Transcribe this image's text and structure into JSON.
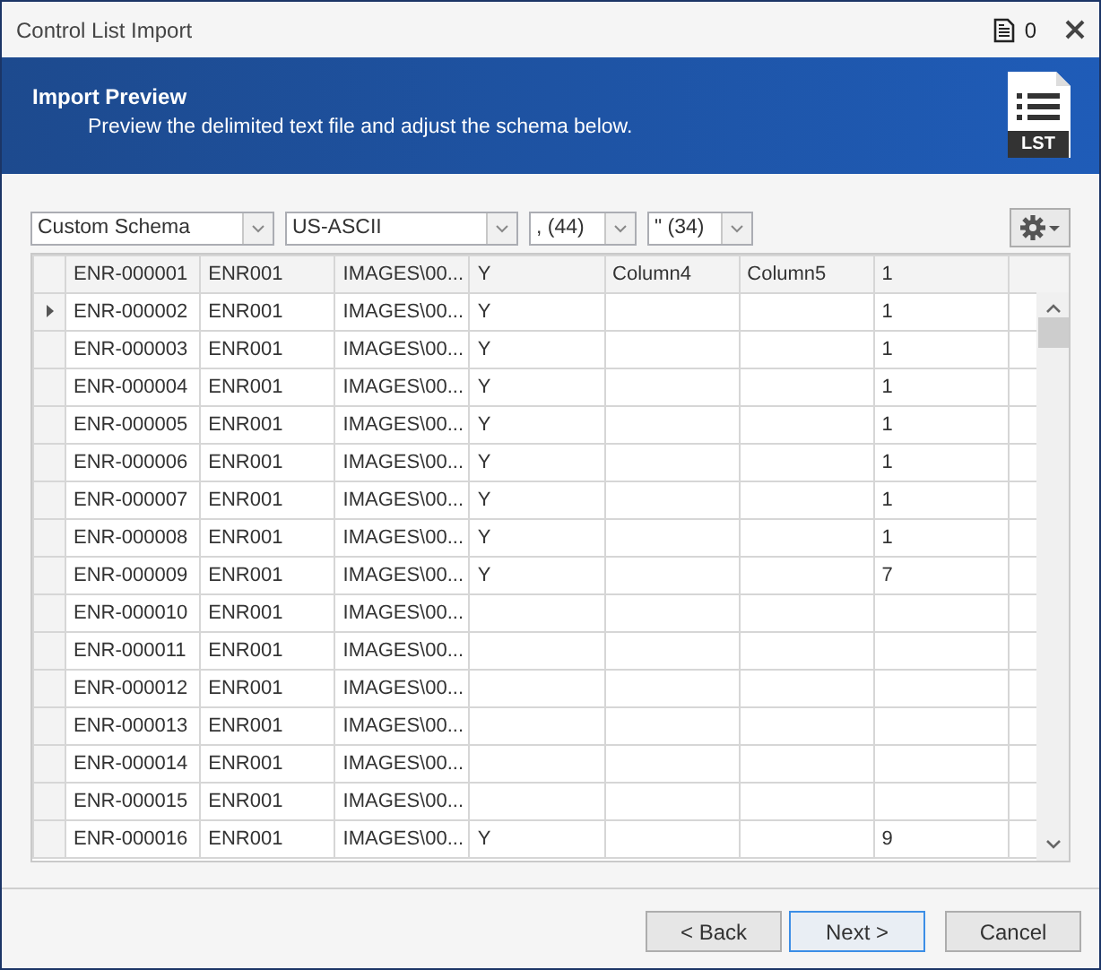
{
  "window": {
    "title": "Control List Import",
    "notification_count": "0"
  },
  "banner": {
    "title": "Import Preview",
    "subtitle": "Preview the delimited text file and adjust the schema below.",
    "file_badge": "LST"
  },
  "toolbar": {
    "dropdowns": [
      {
        "value": "Custom Schema"
      },
      {
        "value": "US-ASCII"
      },
      {
        "value": ", (44)"
      },
      {
        "value": "\" (34)"
      }
    ]
  },
  "grid": {
    "header_row": [
      "ENR-000001",
      "ENR001",
      "IMAGES\\00...",
      "Y",
      "Column4",
      "Column5",
      "1"
    ],
    "rows": [
      {
        "selected": true,
        "cells": [
          "ENR-000002",
          "ENR001",
          "IMAGES\\00...",
          "Y",
          null,
          null,
          "1"
        ]
      },
      {
        "selected": false,
        "cells": [
          "ENR-000003",
          "ENR001",
          "IMAGES\\00...",
          "Y",
          null,
          null,
          "1"
        ]
      },
      {
        "selected": false,
        "cells": [
          "ENR-000004",
          "ENR001",
          "IMAGES\\00...",
          "Y",
          null,
          null,
          "1"
        ]
      },
      {
        "selected": false,
        "cells": [
          "ENR-000005",
          "ENR001",
          "IMAGES\\00...",
          "Y",
          null,
          null,
          "1"
        ]
      },
      {
        "selected": false,
        "cells": [
          "ENR-000006",
          "ENR001",
          "IMAGES\\00...",
          "Y",
          null,
          null,
          "1"
        ]
      },
      {
        "selected": false,
        "cells": [
          "ENR-000007",
          "ENR001",
          "IMAGES\\00...",
          "Y",
          null,
          null,
          "1"
        ]
      },
      {
        "selected": false,
        "cells": [
          "ENR-000008",
          "ENR001",
          "IMAGES\\00...",
          "Y",
          null,
          null,
          "1"
        ]
      },
      {
        "selected": false,
        "cells": [
          "ENR-000009",
          "ENR001",
          "IMAGES\\00...",
          "Y",
          null,
          null,
          "7"
        ]
      },
      {
        "selected": false,
        "cells": [
          "ENR-000010",
          "ENR001",
          "IMAGES\\00...",
          null,
          null,
          null,
          null
        ]
      },
      {
        "selected": false,
        "cells": [
          "ENR-000011",
          "ENR001",
          "IMAGES\\00...",
          null,
          null,
          null,
          null
        ]
      },
      {
        "selected": false,
        "cells": [
          "ENR-000012",
          "ENR001",
          "IMAGES\\00...",
          null,
          null,
          null,
          null
        ]
      },
      {
        "selected": false,
        "cells": [
          "ENR-000013",
          "ENR001",
          "IMAGES\\00...",
          null,
          null,
          null,
          null
        ]
      },
      {
        "selected": false,
        "cells": [
          "ENR-000014",
          "ENR001",
          "IMAGES\\00...",
          null,
          null,
          null,
          null
        ]
      },
      {
        "selected": false,
        "cells": [
          "ENR-000015",
          "ENR001",
          "IMAGES\\00...",
          null,
          null,
          null,
          null
        ]
      },
      {
        "selected": false,
        "cells": [
          "ENR-000016",
          "ENR001",
          "IMAGES\\00...",
          "Y",
          null,
          null,
          "9"
        ]
      }
    ]
  },
  "buttons": [
    {
      "label": "< Back",
      "focused": false
    },
    {
      "label": "Next >",
      "focused": true
    },
    {
      "label": "Cancel",
      "focused": false
    }
  ]
}
